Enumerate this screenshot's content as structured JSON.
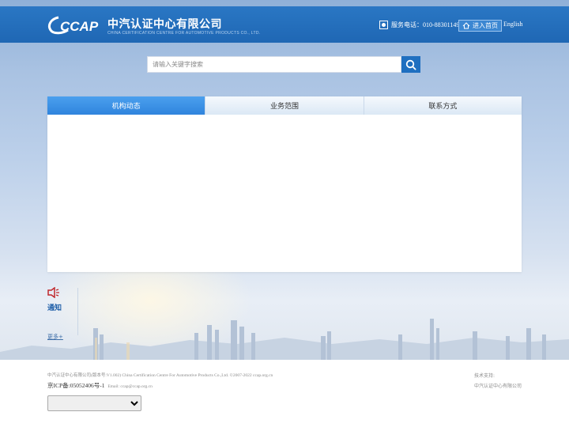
{
  "header": {
    "brand_cn": "中汽认证中心有限公司",
    "brand_en": "CHINA CERTIFICATION CENTRE FOR AUTOMOTIVE PRODUCTS CO., LTD.",
    "logo_text": "CCAP",
    "phone_text": "服务电话：010-88301149",
    "home_label": "进入首页",
    "lang_label": "English",
    "color": "#1f67b4"
  },
  "search": {
    "placeholder": "请输入关键字搜索",
    "value": "",
    "icon": "search-icon"
  },
  "tabs": [
    {
      "label": "机构动态",
      "active": true
    },
    {
      "label": "业务范围",
      "active": false
    },
    {
      "label": "联系方式",
      "active": false
    }
  ],
  "notice": {
    "title": "通知",
    "more": "更多+",
    "icon": "speaker-icon"
  },
  "footer": {
    "copyright": "中汽认证中心有限公司(版本号:V1.002) China Certification Centre For Automotive Products Co.,Ltd. ©2007-2022 ccap.org.cn",
    "icp": "京ICP备:05052406号-1",
    "email": "Email: ccap@ccap.org.cn",
    "tech_label": "技术支持:",
    "tech_company": "中汽认证中心有限公司",
    "select_value": ""
  },
  "colors": {
    "accent": "#2f84dd",
    "tab_inactive": "#dbe8f5",
    "link": "#3d6ea8"
  }
}
